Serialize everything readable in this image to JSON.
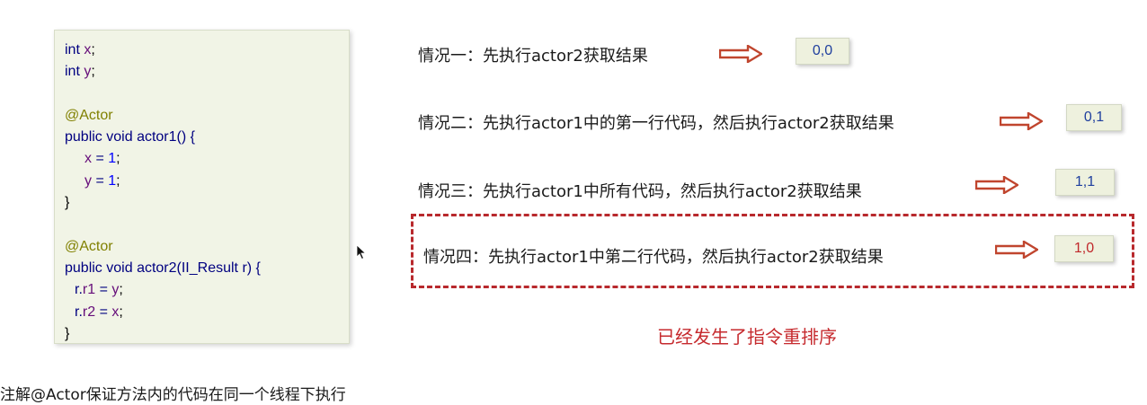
{
  "code": {
    "decl_x_type": "int",
    "decl_x_var": "x",
    "decl_y_type": "int",
    "decl_y_var": "y",
    "anno1": "@Actor",
    "m1_mod": "public void",
    "m1_name": "actor1",
    "m1_params": "() {",
    "m1_l1_var": "x",
    "m1_l1_op": " = ",
    "m1_l1_num": "1",
    "m1_l2_var": "y",
    "m1_l2_op": " = ",
    "m1_l2_num": "1",
    "close1": "}",
    "anno2": "@Actor",
    "m2_mod": "public void",
    "m2_name": "actor2",
    "m2_params": "(II_Result r) {",
    "m2_l1_pre": "r.",
    "m2_l1_field": "r1",
    "m2_l1_op": " = ",
    "m2_l1_var": "y",
    "m2_l2_pre": "r.",
    "m2_l2_field": "r2",
    "m2_l2_op": " = ",
    "m2_l2_var": "x",
    "semi": ";",
    "close2": "}"
  },
  "scenarios": [
    {
      "label": "情况一：先执行actor2获取结果",
      "result": "0,0"
    },
    {
      "label": "情况二：先执行actor1中的第一行代码，然后执行actor2获取结果",
      "result": "0,1"
    },
    {
      "label": "情况三：先执行actor1中所有代码，然后执行actor2获取结果",
      "result": "1,1"
    },
    {
      "label": "情况四：先执行actor1中第二行代码，然后执行actor2获取结果",
      "result": "1,0"
    }
  ],
  "conclusion": "已经发生了指令重排序",
  "note": "注解@Actor保证方法内的代码在同一个线程下执行",
  "colors": {
    "arrow": "#c0452e",
    "highlight": "#b8292d",
    "result_text": "#1f3f9e"
  }
}
